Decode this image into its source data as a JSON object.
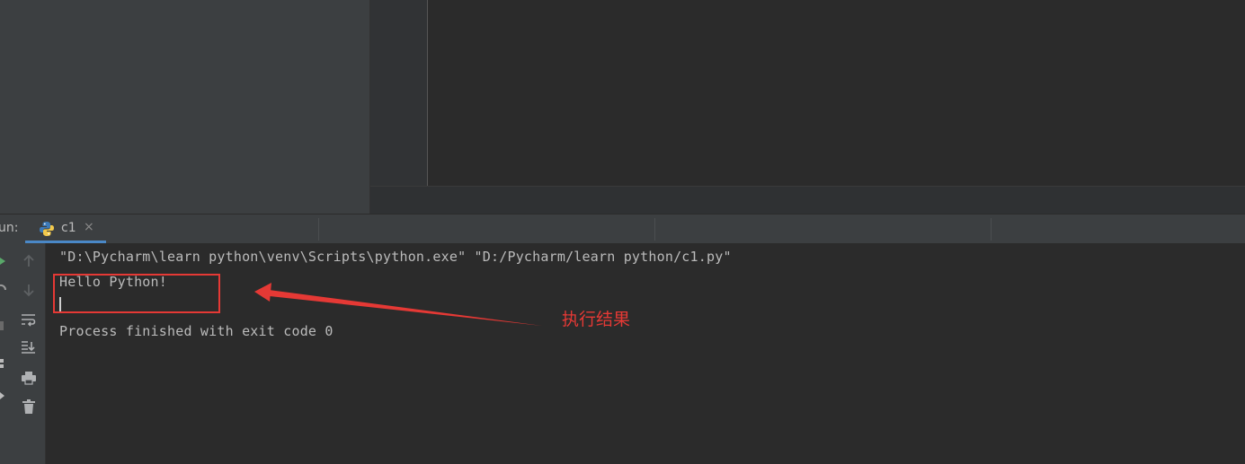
{
  "run_panel": {
    "label": "un:",
    "tab": {
      "label": "c1",
      "close": "×",
      "icon": "python-icon"
    }
  },
  "toolbar": {
    "buttons": [
      "up-arrow-icon",
      "down-arrow-icon",
      "soft-wrap-icon",
      "scroll-to-end-icon",
      "print-icon",
      "trash-icon"
    ]
  },
  "console": {
    "command_line": "\"D:\\Pycharm\\learn python\\venv\\Scripts\\python.exe\" \"D:/Pycharm/learn python/c1.py\"",
    "output_line": "Hello Python!",
    "exit_line": "Process finished with exit code 0"
  },
  "annotation": {
    "label": "执行结果",
    "color": "#e53935"
  },
  "colors": {
    "background": "#2b2b2b",
    "panel": "#3c3f41",
    "tab_underline": "#4a88c7",
    "text": "#bbbbbb"
  }
}
